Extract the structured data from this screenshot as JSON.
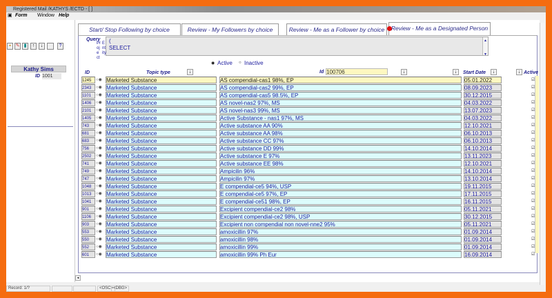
{
  "window": {
    "title": "Registered Mail /KATHYS /ECTD - [ ]"
  },
  "menu": {
    "form": "Form",
    "window": "Window",
    "help": "Help"
  },
  "toolbar": {
    "icons": [
      "save-icon",
      "edit-icon",
      "exit-door-icon",
      "arrow-up-icon",
      "arrow-down-icon",
      "blank-icon",
      "help-icon"
    ],
    "help_label": "?"
  },
  "user": {
    "name": "Kathy Sims",
    "id_label": "ID",
    "id_value": "1001"
  },
  "tabs": [
    {
      "label": "Start/ Stop Following by choice"
    },
    {
      "label": "Review - My Followers by choice"
    },
    {
      "label": "Review - Me as a Follower by choice"
    },
    {
      "label": "Review - Me as a Designated Person",
      "active": true
    }
  ],
  "query": {
    "label": "Query",
    "text_line1": "(",
    "text_line2": "SELECT"
  },
  "vertical_labels": {
    "project": "Project",
    "entity": "Entity"
  },
  "filter": {
    "active": "Active",
    "inactive": "Inactive",
    "selected": "Active"
  },
  "columns": {
    "id": "ID",
    "topic_type": "Topic type",
    "id_filter_label": "Id",
    "id_filter_value": "100706",
    "start_date": "Start Date",
    "active": "Active"
  },
  "rows": [
    {
      "id": "1245",
      "topic": "Marketed Substance",
      "name": "AS compendial-cas1 98%, EP",
      "date": "05.01.2022",
      "active": true
    },
    {
      "id": "2343",
      "topic": "Marketed Substance",
      "name": "AS compendial-cas2 99%, EP",
      "date": "08.09.2023",
      "active": true
    },
    {
      "id": "1101",
      "topic": "Marketed Substance",
      "name": "AS compendial-cas5 98.5%, EP",
      "date": "30.12.2015",
      "active": true
    },
    {
      "id": "1406",
      "topic": "Marketed Substance",
      "name": "AS novel-nas2 97%, MS",
      "date": "04.03.2022",
      "active": true
    },
    {
      "id": "2101",
      "topic": "Marketed Substance",
      "name": "AS novel-nas3 99%, MS",
      "date": "13.07.2023",
      "active": true
    },
    {
      "id": "1405",
      "topic": "Marketed Substance",
      "name": "Active Substance - nas1 97%, MS",
      "date": "04.03.2022",
      "active": true
    },
    {
      "id": "743",
      "topic": "Marketed Substance",
      "name": "Active substance AA 90%",
      "date": "12.10.2021",
      "active": true
    },
    {
      "id": "681",
      "topic": "Marketed Substance",
      "name": "Active substance AA 98%",
      "date": "06.10.2013",
      "active": true
    },
    {
      "id": "683",
      "topic": "Marketed Substance",
      "name": "Active substance CC 97%",
      "date": "06.10.2013",
      "active": true
    },
    {
      "id": "756",
      "topic": "Marketed Substance",
      "name": "Active substance DD 99%",
      "date": "14.10.2014",
      "active": true
    },
    {
      "id": "2502",
      "topic": "Marketed Substance",
      "name": "Active substance E 97%",
      "date": "13.11.2023",
      "active": true
    },
    {
      "id": "741",
      "topic": "Marketed Substance",
      "name": "Active substance EE 98%",
      "date": "12.10.2021",
      "active": true
    },
    {
      "id": "749",
      "topic": "Marketed Substance",
      "name": "Ampicilin 96%",
      "date": "14.10.2014",
      "active": true
    },
    {
      "id": "747",
      "topic": "Marketed Substance",
      "name": "Ampicilin 97%",
      "date": "13.10.2014",
      "active": true
    },
    {
      "id": "1048",
      "topic": "Marketed Substance",
      "name": "E compendial-ce5 94%, USP",
      "date": "19.11.2015",
      "active": true
    },
    {
      "id": "1013",
      "topic": "Marketed Substance",
      "name": "E compendial-ce5 97%, EP",
      "date": "17.11.2015",
      "active": true
    },
    {
      "id": "1041",
      "topic": "Marketed Substance",
      "name": "E compendial-ce51 98%, EP",
      "date": "16.11.2015",
      "active": true
    },
    {
      "id": "901",
      "topic": "Marketed Substance",
      "name": "Excipient compendial-ce2 98%",
      "date": "05.11.2021",
      "active": true
    },
    {
      "id": "1106",
      "topic": "Marketed Substance",
      "name": "Excipient compendial-ce2 98%, USP",
      "date": "30.12.2015",
      "active": true
    },
    {
      "id": "903",
      "topic": "Marketed Substance",
      "name": "Excipient non compendial non novel-nne2 95%",
      "date": "05.11.2021",
      "active": true
    },
    {
      "id": "553",
      "topic": "Marketed Substance",
      "name": "amoxicillin 97%",
      "date": "01.09.2014",
      "active": true
    },
    {
      "id": "550",
      "topic": "Marketed Substance",
      "name": "amoxicillin 98%",
      "date": "01.09.2014",
      "active": true
    },
    {
      "id": "552",
      "topic": "Marketed Substance",
      "name": "amoxicillin 99%",
      "date": "01.09.2014",
      "active": true
    },
    {
      "id": "601",
      "topic": "Marketed Substance",
      "name": "amoxicillin 99% Ph Eur",
      "date": "16.09.2014",
      "active": true
    }
  ],
  "status": {
    "record": "Record: 1/? ",
    "osc": "<OSC>",
    "dbg": "<DBG>"
  },
  "colors": {
    "frame": "#f56c10",
    "row_bg": "#dcfcfc",
    "selected_row": "#fdf7c0",
    "text": "#2020a0"
  }
}
